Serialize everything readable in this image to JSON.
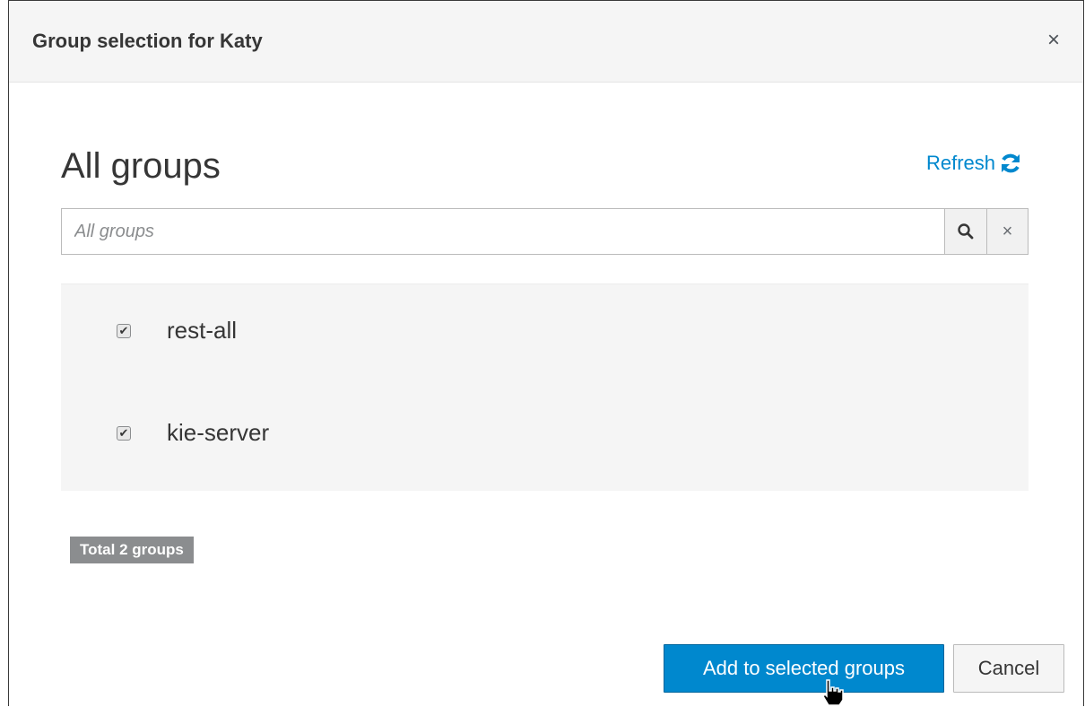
{
  "dialog": {
    "title": "Group selection for Katy",
    "close_glyph": "×"
  },
  "section": {
    "title": "All groups",
    "refresh_label": "Refresh"
  },
  "search": {
    "placeholder": "All groups",
    "value": "",
    "clear_glyph": "×"
  },
  "groups": [
    {
      "label": "rest-all",
      "checked": true
    },
    {
      "label": "kie-server",
      "checked": true
    }
  ],
  "total_label": "Total 2 groups",
  "buttons": {
    "add_label": "Add to selected groups",
    "cancel_label": "Cancel"
  },
  "colors": {
    "primary": "#0088ce",
    "badge": "#8b8d8f"
  }
}
